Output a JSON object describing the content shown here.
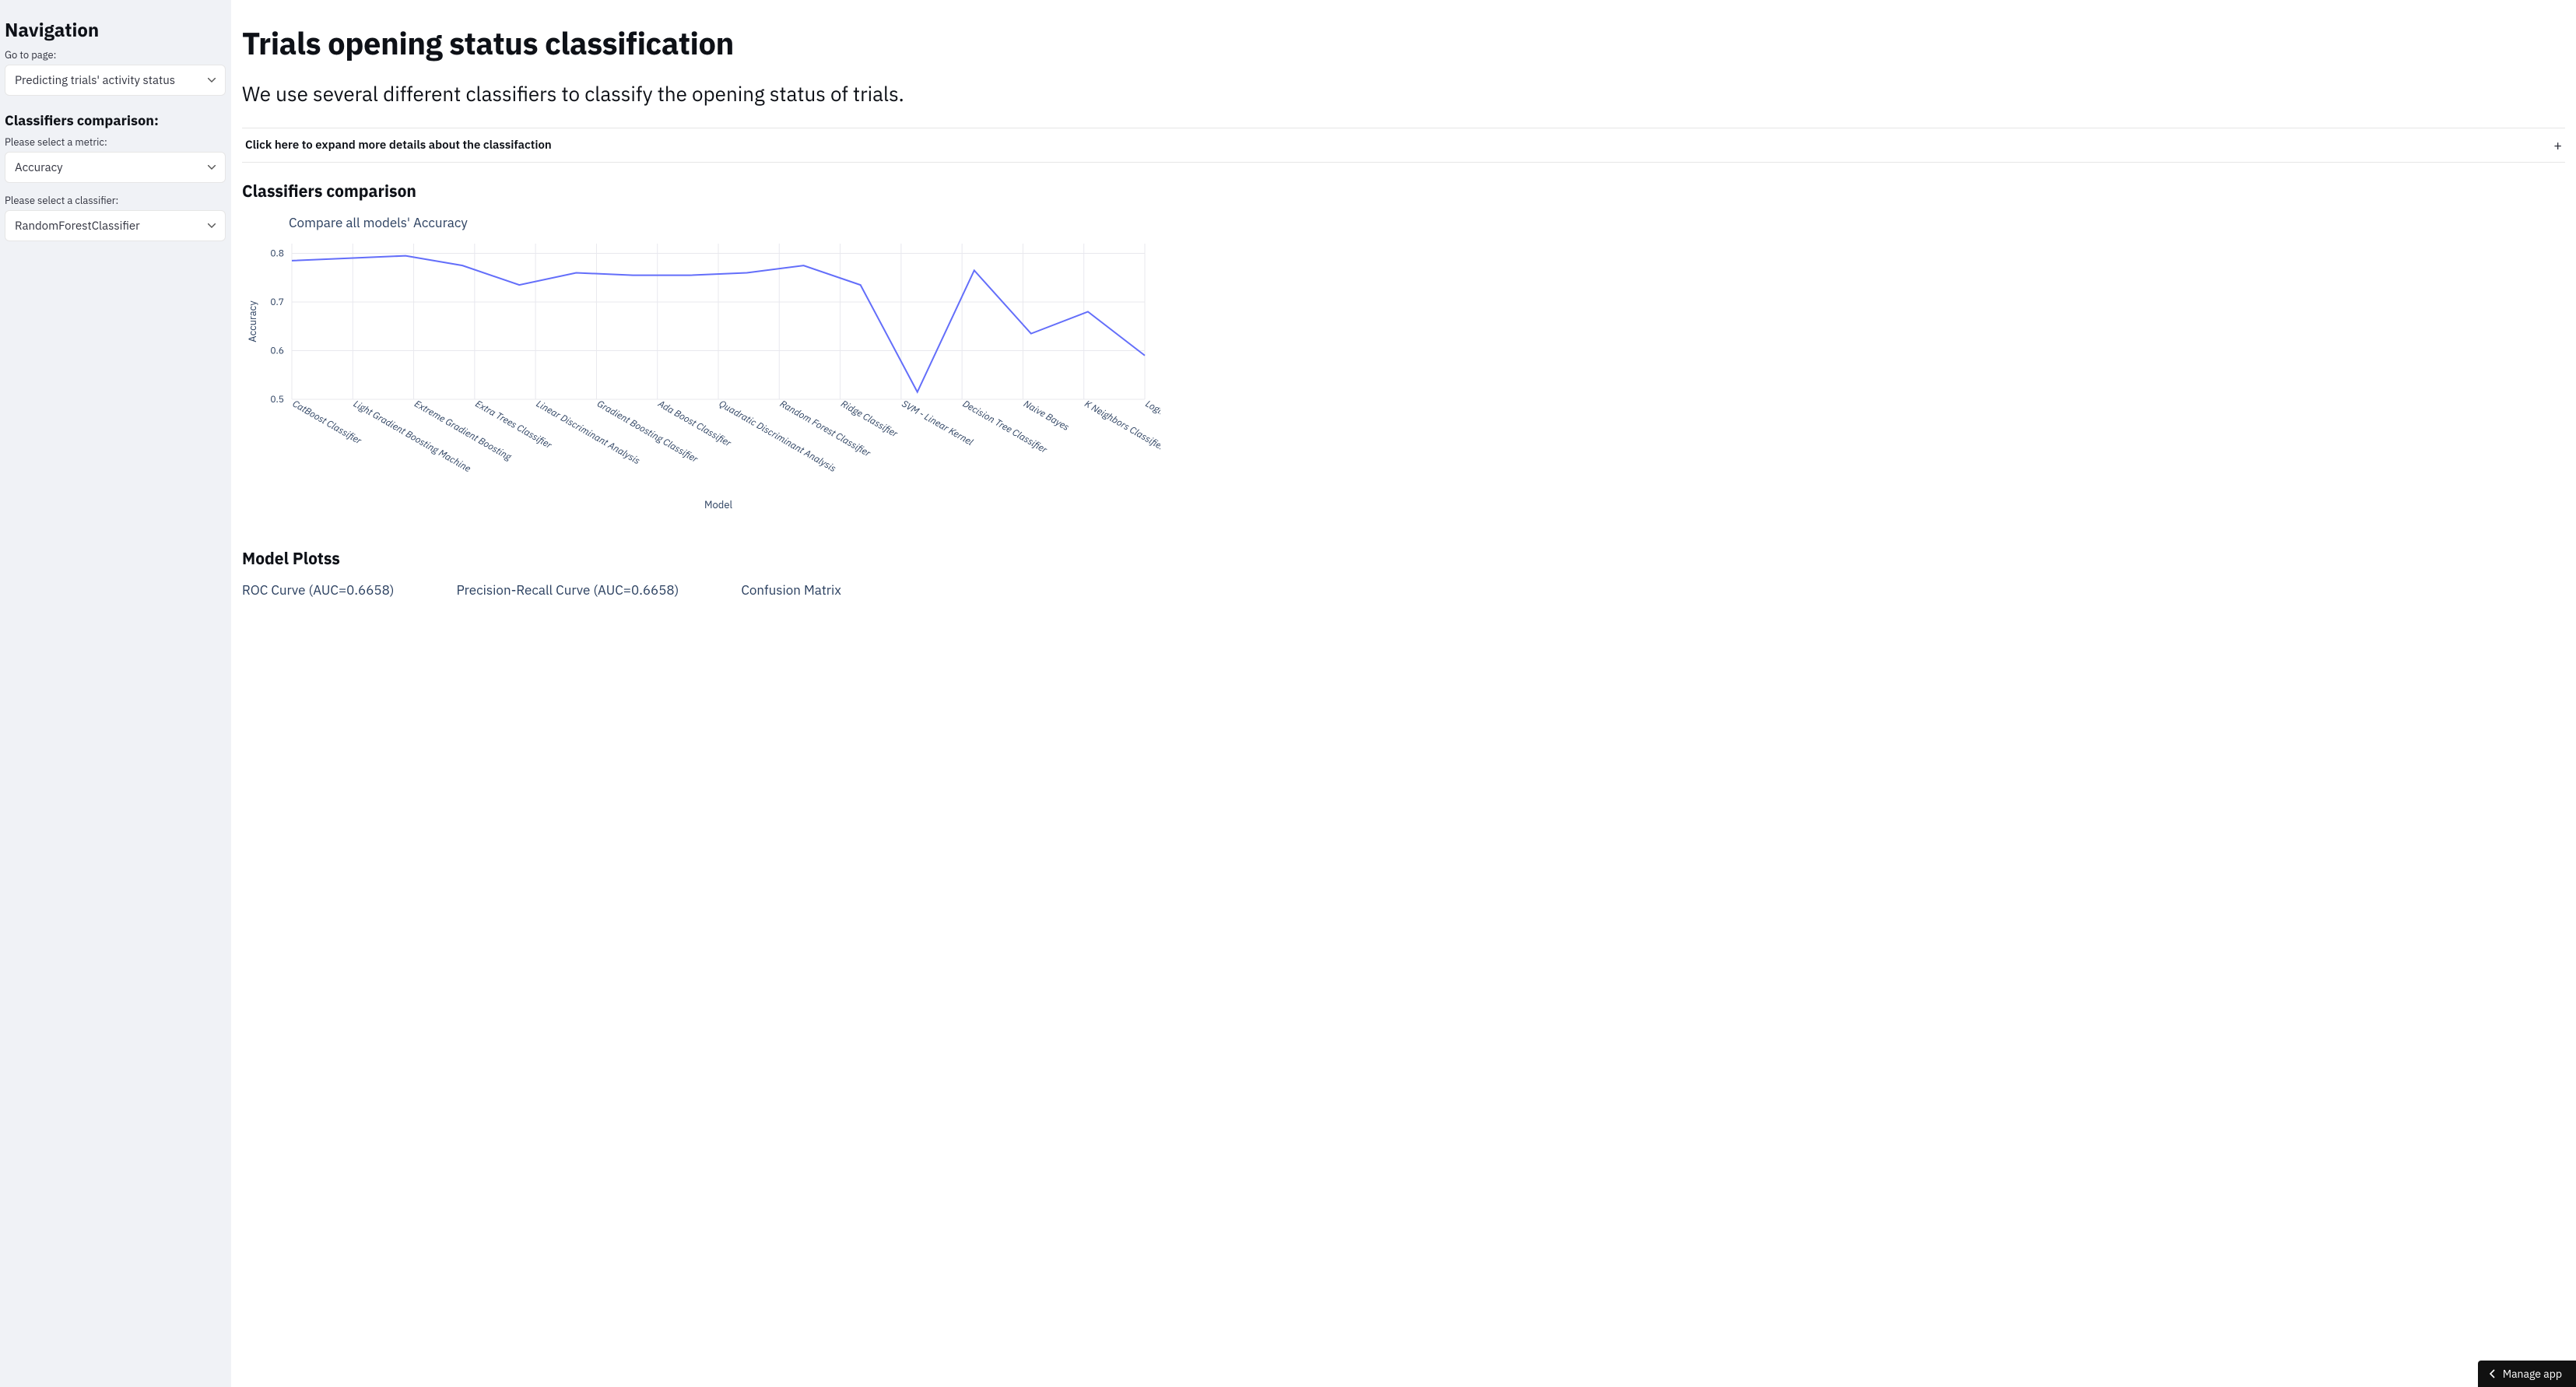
{
  "sidebar": {
    "title": "Navigation",
    "goto_label": "Go to page:",
    "goto_value": "Predicting trials' activity status",
    "compare_title": "Classifiers comparison:",
    "metric_label": "Please select a metric:",
    "metric_value": "Accuracy",
    "classifier_label": "Please select a classifier:",
    "classifier_value": "RandomForestClassifier"
  },
  "main": {
    "title": "Trials opening status classification",
    "subtitle": "We use several different classifiers to classify the opening status of trials.",
    "expander_label": "Click here to expand more details about the classifaction",
    "compare_heading": "Classifiers comparison",
    "plots_heading": "Model Plotss",
    "plot_titles": {
      "roc": "ROC Curve (AUC=0.6658)",
      "pr": "Precision-Recall Curve (AUC=0.6658)",
      "cm": "Confusion Matrix"
    }
  },
  "chart_data": {
    "type": "line",
    "title": "Compare all models' Accuracy",
    "xlabel": "Model",
    "ylabel": "Accuracy",
    "ylim": [
      0.5,
      0.82
    ],
    "yticks": [
      0.5,
      0.6,
      0.7,
      0.8
    ],
    "categories": [
      "CatBoost Classifier",
      "Light Gradient Boosting Machine",
      "Extreme Gradient Boosting",
      "Extra Trees Classifier",
      "Linear Discriminant Analysis",
      "Gradient Boosting Classifier",
      "Ada Boost Classifier",
      "Quadratic Discriminant Analysis",
      "Random Forest Classifier",
      "Ridge Classifier",
      "SVM - Linear Kernel",
      "Decision Tree Classifier",
      "Naive Bayes",
      "K Neighbors Classifier",
      "Logistic Regression"
    ],
    "values": [
      0.785,
      0.79,
      0.795,
      0.775,
      0.735,
      0.76,
      0.755,
      0.755,
      0.76,
      0.775,
      0.735,
      0.515,
      0.765,
      0.635,
      0.68,
      0.59
    ]
  },
  "footer": {
    "manage_app": "Manage app"
  }
}
